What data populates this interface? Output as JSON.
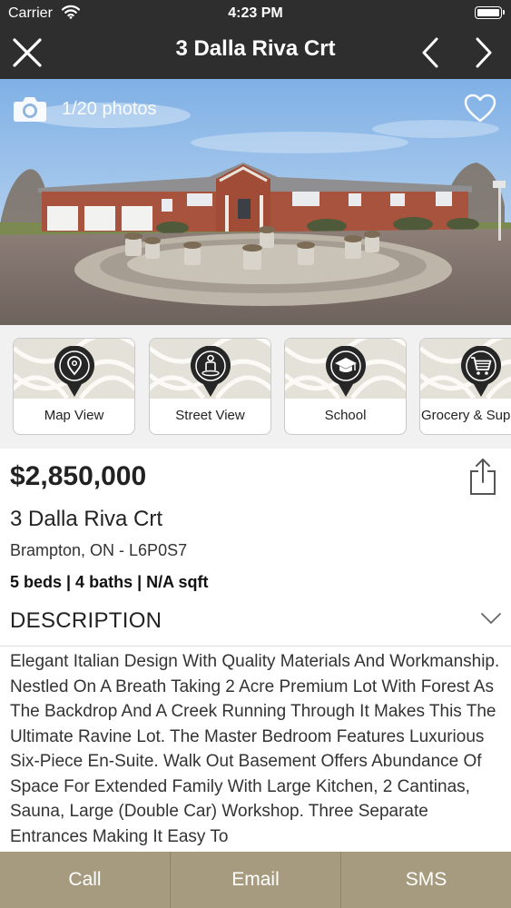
{
  "status_bar": {
    "carrier": "Carrier",
    "time": "4:23 PM"
  },
  "nav": {
    "title": "3 Dalla Riva Crt",
    "close_icon": "close-icon",
    "prev_icon": "chevron-left-icon",
    "next_icon": "chevron-right-icon"
  },
  "gallery": {
    "photo_count": "1/20 photos",
    "camera_icon": "camera-icon",
    "favorite_icon": "heart-icon"
  },
  "quick_actions": [
    {
      "label": "Map View",
      "icon": "map-pin-icon"
    },
    {
      "label": "Street View",
      "icon": "street-view-icon"
    },
    {
      "label": "School",
      "icon": "graduation-cap-icon"
    },
    {
      "label": "Grocery & Supermarket",
      "icon": "shopping-cart-icon"
    }
  ],
  "listing": {
    "price": "$2,850,000",
    "address": "3 Dalla Riva Crt",
    "city_line": "Brampton, ON - L6P0S7",
    "specs": "5 beds | 4 baths | N/A sqft",
    "description_heading": "DESCRIPTION",
    "description": "Elegant Italian Design With Quality Materials And Workmanship. Nestled On A Breath Taking 2 Acre Premium Lot With Forest As The Backdrop And A Creek Running Through It Makes This The Ultimate Ravine Lot. The Master Bedroom Features Luxurious Six-Piece En-Suite. Walk Out Basement Offers Abundance Of Space For Extended Family With Large Kitchen, 2 Cantinas, Sauna, Large (Double Car) Workshop. Three Separate Entrances Making It Easy To"
  },
  "actions": {
    "call": "Call",
    "email": "Email",
    "sms": "SMS"
  },
  "colors": {
    "nav_bg": "#2e2e2e",
    "accent_gold": "#a69b7f",
    "tile_pattern": "#e4e1d9"
  }
}
